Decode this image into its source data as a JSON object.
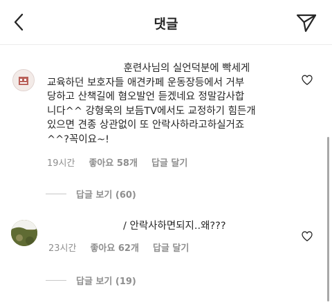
{
  "header": {
    "title": "댓글",
    "back_icon": "chevron-left-icon",
    "send_icon": "paper-plane-icon"
  },
  "comments": [
    {
      "text": "                        훈련사님의 실언덕분에 빡세게\n교육하던 보호자들 애견카페 운동장등에서 거부\n당하고 산책길에 혐오발언 듣겠네요 정말감사합\n니다^^ 강형욱의 보듬TV에서도 교정하기 힘든개\n있으면 견종 상관없이 또 안락사하라고하실거죠\n^^?꼭이요~!",
      "time": "19시간",
      "likes": "좋아요 58개",
      "reply_label": "답글 달기",
      "view_replies": "답글 보기 (60)",
      "like_icon": "heart-outline-icon"
    },
    {
      "text": "/ 안락사하면되지..왜???",
      "time": "23시간",
      "likes": "좋아요 62개",
      "reply_label": "답글 달기",
      "view_replies": "답글 보기 (19)",
      "like_icon": "heart-outline-icon"
    }
  ]
}
